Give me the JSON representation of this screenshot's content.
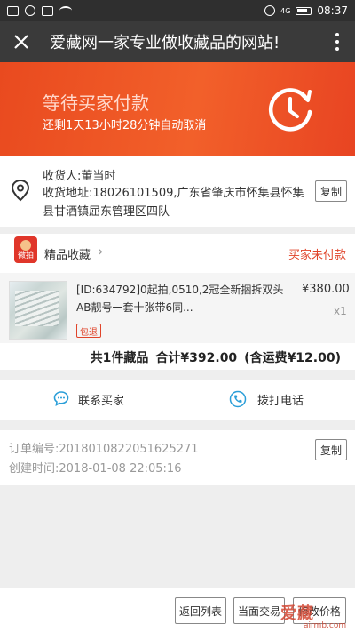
{
  "status_bar": {
    "network": "4G",
    "time": "08:37"
  },
  "header": {
    "title": "爱藏网一家专业做收藏品的网站!"
  },
  "banner": {
    "status": "等待买家付款",
    "countdown": "还剩1天13小时28分钟自动取消"
  },
  "address": {
    "receiver_label": "收货人:",
    "receiver": "董当时",
    "address_label": "收货地址:",
    "address": "18026101509,广东省肇庆市怀集县怀集县甘洒镇屈东管理区四队",
    "copy_label": "复制"
  },
  "shop": {
    "logo_text": "微拍",
    "name": "精品收藏",
    "order_status": "买家未付款"
  },
  "item": {
    "title": "[ID:634792]0起拍,0510,2冠全新捆拆双头AB靓号一套十张带6同...",
    "price": "¥380.00",
    "quantity": "x1",
    "badge": "包退"
  },
  "summary": {
    "count_text": "共1件藏品",
    "total_text": "合计¥392.00",
    "shipping_text": "(含运费¥12.00)"
  },
  "contact": {
    "contact_seller": "联系买家",
    "call": "拨打电话"
  },
  "meta": {
    "order_no_label": "订单编号:",
    "order_no": "2018010822051625271",
    "created_label": "创建时间:",
    "created_at": "2018-01-08 22:05:16",
    "copy_label": "复制"
  },
  "actions": {
    "back": "返回列表",
    "face_trade": "当面交易",
    "modify_price": "修改价格"
  },
  "watermark": {
    "logo": "爱藏",
    "site": "airmb.com"
  },
  "colors": {
    "accent": "#e94a1f",
    "header_bg": "#3a3a3a",
    "status_red": "#e0442a"
  }
}
